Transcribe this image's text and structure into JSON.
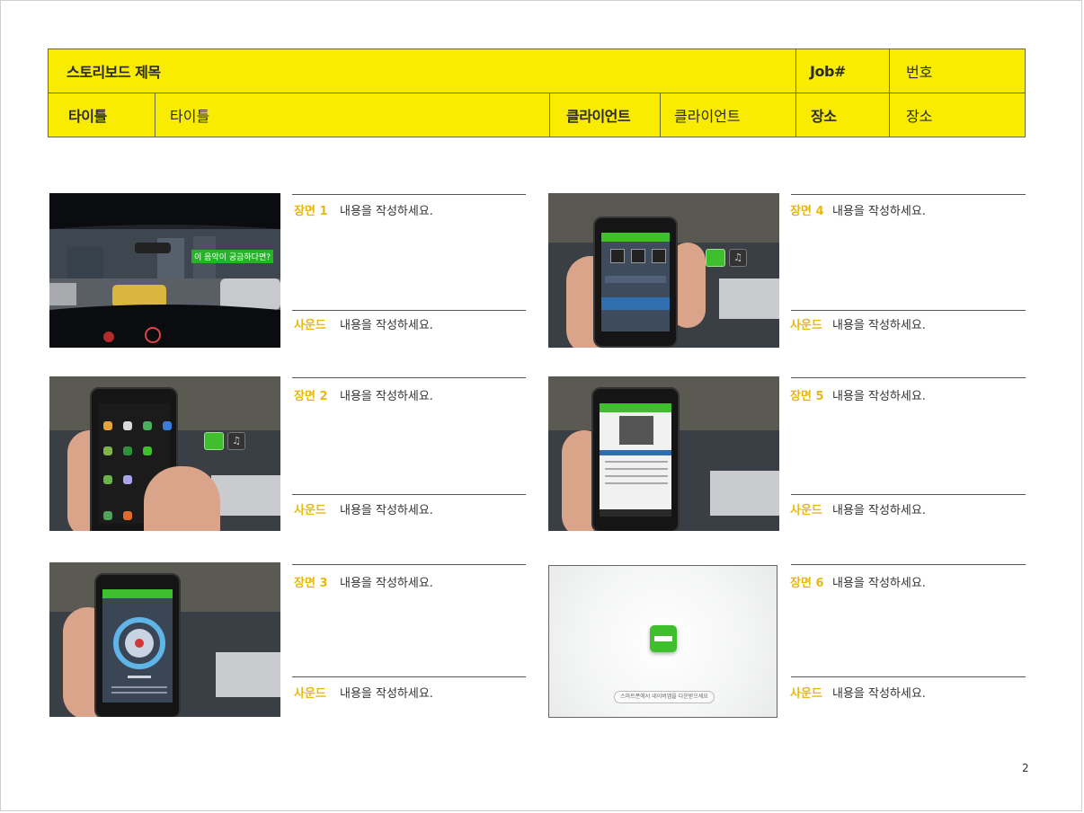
{
  "header": {
    "title_label": "스토리보드 제목",
    "job_label": "Job#",
    "job_value": "번호",
    "title_row_label": "타이틀",
    "title_row_value": "타이틀",
    "client_label": "클라이언트",
    "client_value": "클라이언트",
    "location_label": "장소",
    "location_value": "장소"
  },
  "scenes": [
    {
      "scene_label": "장면 1",
      "scene_text": "내용을 작성하세요.",
      "sound_label": "사운드",
      "sound_text": "내용을 작성하세요.",
      "overlay_text": "이 음악이 궁금하다면?"
    },
    {
      "scene_label": "장면 2",
      "scene_text": "내용을 작성하세요.",
      "sound_label": "사운드",
      "sound_text": "내용을 작성하세요."
    },
    {
      "scene_label": "장면 3",
      "scene_text": "내용을 작성하세요.",
      "sound_label": "사운드",
      "sound_text": "내용을 작성하세요."
    },
    {
      "scene_label": "장면 4",
      "scene_text": "내용을 작성하세요.",
      "sound_label": "사운드",
      "sound_text": "내용을 작성하세요."
    },
    {
      "scene_label": "장면 5",
      "scene_text": "내용을 작성하세요.",
      "sound_label": "사운드",
      "sound_text": "내용을 작성하세요."
    },
    {
      "scene_label": "장면 6",
      "scene_text": "내용을 작성하세요.",
      "sound_label": "사운드",
      "sound_text": "내용을 작성하세요.",
      "pill_text": "스마트폰에서 네이버앱을 다운받으세요"
    }
  ],
  "page_number": "2",
  "colors": {
    "header_bg": "#f9ec00",
    "label_accent": "#e8b80c",
    "naver_green": "#3fbf2e"
  },
  "icons": [
    "naver-app-icon",
    "music-app-icon",
    "record-button-icon"
  ]
}
